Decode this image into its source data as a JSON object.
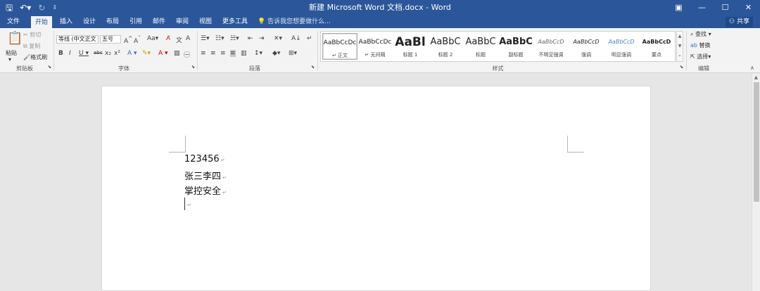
{
  "titlebar": {
    "save_icon": "save-icon",
    "undo_icon": "undo-icon",
    "redo_icon": "redo-icon",
    "title": "新建 Microsoft Word 文档.docx - Word",
    "ribbon_display_icon": "ribbon-display-options-icon",
    "minimize": "—",
    "maximize": "☐",
    "close": "✕"
  },
  "tabs": [
    {
      "label": "文件"
    },
    {
      "label": "开始"
    },
    {
      "label": "插入"
    },
    {
      "label": "设计"
    },
    {
      "label": "布局"
    },
    {
      "label": "引用"
    },
    {
      "label": "邮件"
    },
    {
      "label": "审阅"
    },
    {
      "label": "视图"
    },
    {
      "label": "更多工具"
    }
  ],
  "tell_me": "告诉我您想要做什么...",
  "share": "共享",
  "clipboard": {
    "paste": "粘贴",
    "cut": "剪切",
    "copy": "复制",
    "format_painter": "格式刷",
    "group_label": "剪贴板"
  },
  "font": {
    "font_name": "等线 (中文正文",
    "font_size": "五号",
    "group_label": "字体"
  },
  "paragraph": {
    "group_label": "段落"
  },
  "styles": {
    "items": [
      {
        "sample": "AaBbCcDc",
        "name": "正文"
      },
      {
        "sample": "AaBbCcDc",
        "name": "无间隔"
      },
      {
        "sample": "AaBl",
        "name": "标题 1"
      },
      {
        "sample": "AaBbC",
        "name": "标题 2"
      },
      {
        "sample": "AaBbC",
        "name": "标题"
      },
      {
        "sample": "AaBbC",
        "name": "副标题"
      },
      {
        "sample": "AaBbCcD",
        "name": "不明显强调"
      },
      {
        "sample": "AaBbCcD",
        "name": "强调"
      },
      {
        "sample": "AaBbCcD",
        "name": "明显强调"
      },
      {
        "sample": "AaBbCcD",
        "name": "要点"
      }
    ],
    "group_label": "样式"
  },
  "editing": {
    "find": "查找",
    "replace": "替换",
    "select": "选择",
    "group_label": "编辑"
  },
  "document": {
    "lines": [
      "123456",
      "张三李四",
      "掌控安全"
    ],
    "para_mark": "↵"
  },
  "colors": {
    "brand": "#2b579a",
    "ribbon_bg": "#f3f3f3",
    "canvas_bg": "#e6e6e6"
  }
}
